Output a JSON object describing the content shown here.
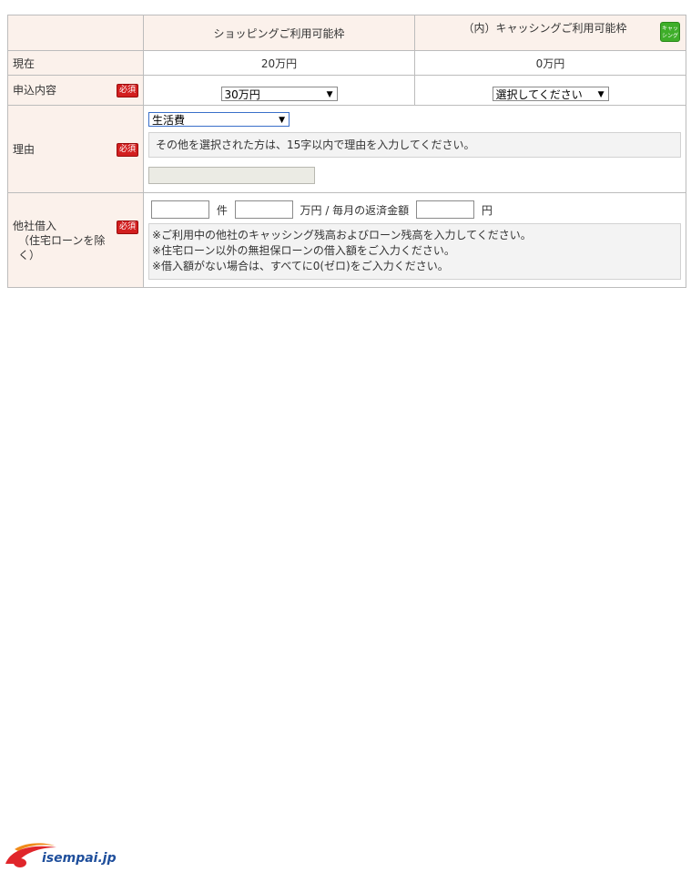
{
  "header": {
    "shopping_label": "ショッピングご利用可能枠",
    "cashing_label": "（内）キャッシングご利用可能枠",
    "cashing_badge": "キャッシング"
  },
  "rows": {
    "current": {
      "label": "現在",
      "shopping_value": "20万円",
      "cashing_value": "0万円"
    },
    "apply": {
      "label": "申込内容",
      "required": "必須",
      "shopping_selected": "30万円",
      "cashing_selected": "選択してください"
    },
    "reason": {
      "label": "理由",
      "required": "必須",
      "selected": "生活費",
      "note": "その他を選択された方は、15字以内で理由を入力してください。"
    },
    "other_loans": {
      "label_line1": "他社借入",
      "label_line2": "（住宅ローンを除く）",
      "required": "必須",
      "unit_count": "件",
      "unit_amount": "万円 / 毎月の返済金額",
      "unit_yen": "円",
      "notes": [
        "※ご利用中の他社のキャッシング残高およびローン残高を入力してください。",
        "※住宅ローン以外の無担保ローンの借入額をご入力ください。",
        "※借入額がない場合は、すべてに0(ゼロ)をご入力ください。"
      ]
    }
  },
  "footer": {
    "logo_text": "isempai.jp"
  },
  "colors": {
    "header_bg": "#fbf1eb",
    "required_red": "#d21f1f",
    "badge_green": "#3fae2a",
    "logo_blue": "#1f4f9c",
    "logo_red": "#e0262b"
  }
}
